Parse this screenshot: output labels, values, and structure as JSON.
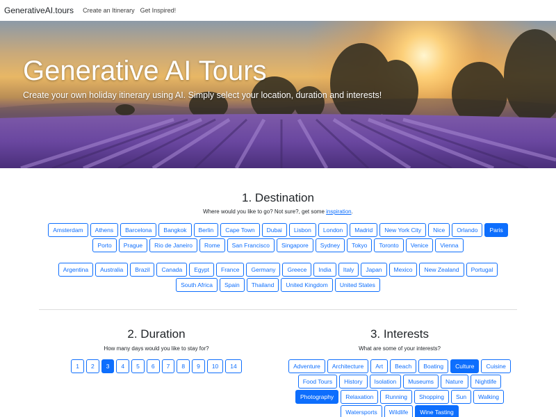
{
  "navbar": {
    "brand": "GenerativeAI.tours",
    "links": [
      "Create an Itinerary",
      "Get Inspired!"
    ]
  },
  "hero": {
    "title": "Generative AI Tours",
    "subtitle": "Create your own holiday itinerary using AI. Simply select your location, duration and interests!"
  },
  "destination": {
    "title": "1. Destination",
    "subtitle_prefix": "Where would you like to go? Not sure?, get some ",
    "subtitle_link": "inspiration",
    "subtitle_suffix": ".",
    "cities": [
      "Amsterdam",
      "Athens",
      "Barcelona",
      "Bangkok",
      "Berlin",
      "Cape Town",
      "Dubai",
      "Lisbon",
      "London",
      "Madrid",
      "New York City",
      "Nice",
      "Orlando",
      "Paris",
      "Porto",
      "Prague",
      "Rio de Janeiro",
      "Rome",
      "San Francisco",
      "Singapore",
      "Sydney",
      "Tokyo",
      "Toronto",
      "Venice",
      "Vienna"
    ],
    "selected_city": "Paris",
    "countries": [
      "Argentina",
      "Australia",
      "Brazil",
      "Canada",
      "Egypt",
      "France",
      "Germany",
      "Greece",
      "India",
      "Italy",
      "Japan",
      "Mexico",
      "New Zealand",
      "Portugal",
      "South Africa",
      "Spain",
      "Thailand",
      "United Kingdom",
      "United States"
    ]
  },
  "duration": {
    "title": "2. Duration",
    "subtitle": "How many days would you like to stay for?",
    "days": [
      "1",
      "2",
      "3",
      "4",
      "5",
      "6",
      "7",
      "8",
      "9",
      "10",
      "14"
    ],
    "selected": "3"
  },
  "interests": {
    "title": "3. Interests",
    "subtitle": "What are some of your interests?",
    "items": [
      "Adventure",
      "Architecture",
      "Art",
      "Beach",
      "Boating",
      "Culture",
      "Cuisine",
      "Food Tours",
      "History",
      "Isolation",
      "Museums",
      "Nature",
      "Nightlife",
      "Photography",
      "Relaxation",
      "Running",
      "Shopping",
      "Sun",
      "Walking",
      "Watersports",
      "Wildlife",
      "Wine Tasting"
    ],
    "selected": [
      "Culture",
      "Photography",
      "Wine Tasting"
    ]
  },
  "colors": {
    "primary": "#0d6efd",
    "text": "#212529"
  }
}
